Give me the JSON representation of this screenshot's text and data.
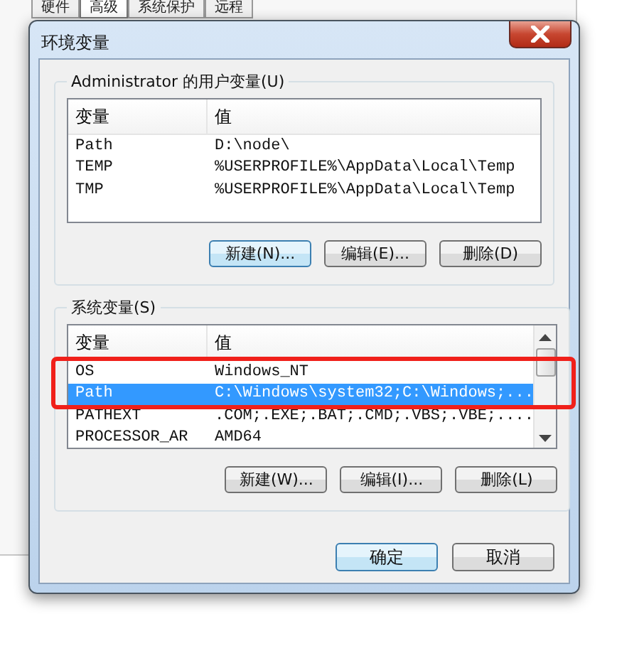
{
  "background_window": {
    "tabs": [
      {
        "label": "硬件",
        "selected": false
      },
      {
        "label": "高级",
        "selected": true
      },
      {
        "label": "系统保护",
        "selected": false
      },
      {
        "label": "远程",
        "selected": false
      }
    ]
  },
  "window": {
    "title": "环境变量"
  },
  "user_variables": {
    "label": "Administrator 的用户变量(U)",
    "columns": [
      "变量",
      "值"
    ],
    "rows": [
      {
        "name": "Path",
        "value": "D:\\node\\",
        "selected": false,
        "annotated": false
      },
      {
        "name": "TEMP",
        "value": "%USERPROFILE%\\AppData\\Local\\Temp",
        "selected": false,
        "annotated": false
      },
      {
        "name": "TMP",
        "value": "%USERPROFILE%\\AppData\\Local\\Temp",
        "selected": false,
        "annotated": false
      }
    ],
    "buttons": [
      {
        "label": "新建(N)...",
        "default": true
      },
      {
        "label": "编辑(E)...",
        "default": false
      },
      {
        "label": "删除(D)",
        "default": false
      }
    ]
  },
  "system_variables": {
    "label": "系统变量(S)",
    "columns": [
      "变量",
      "值"
    ],
    "rows": [
      {
        "name": "OS",
        "value": "Windows_NT",
        "selected": false,
        "annotated": true
      },
      {
        "name": "Path",
        "value": "C:\\Windows\\system32;C:\\Windows;...",
        "selected": true,
        "annotated": true
      },
      {
        "name": "PATHEXT",
        "value": ".COM;.EXE;.BAT;.CMD;.VBS;.VBE;....",
        "selected": false,
        "annotated": false
      },
      {
        "name": "PROCESSOR_AR",
        "value": "AMD64",
        "selected": false,
        "annotated": false
      }
    ],
    "scrollbar": true,
    "buttons": [
      {
        "label": "新建(W)...",
        "default": false
      },
      {
        "label": "编辑(I)...",
        "default": false
      },
      {
        "label": "删除(L)",
        "default": false
      }
    ]
  },
  "buttons": [
    {
      "label": "确定",
      "default": true
    },
    {
      "label": "取消",
      "default": false
    }
  ]
}
